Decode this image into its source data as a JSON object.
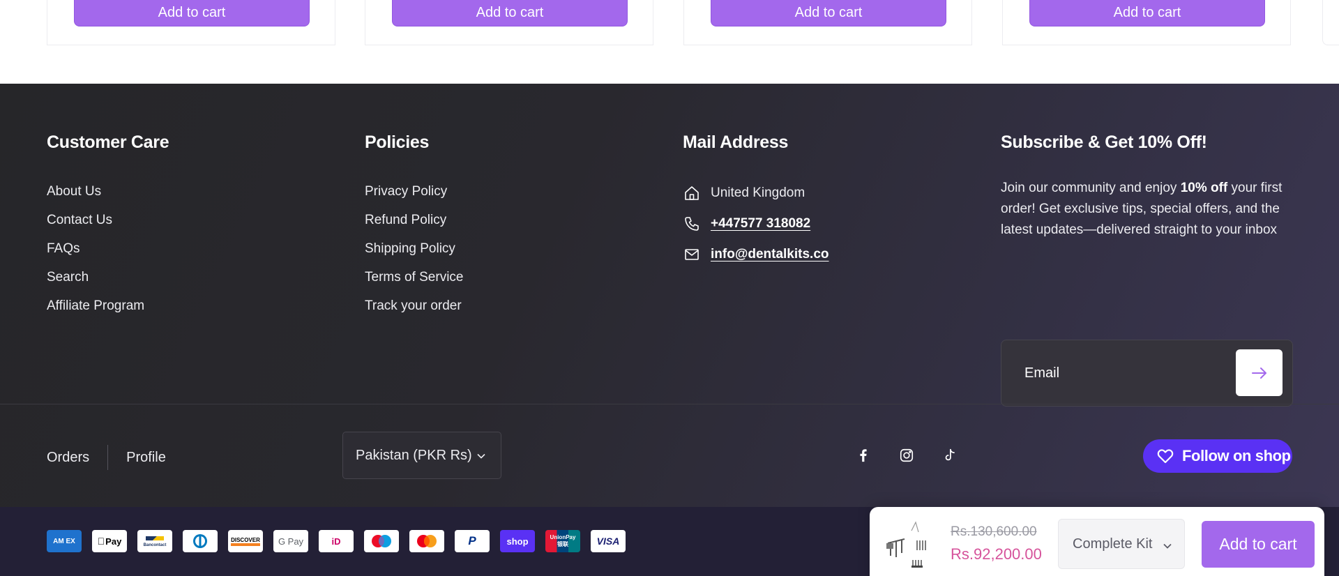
{
  "product_strip": {
    "cards": [
      {
        "button_label": "Add to cart"
      },
      {
        "button_label": "Add to cart"
      },
      {
        "button_label": "Add to cart"
      },
      {
        "button_label": "Add to cart"
      }
    ]
  },
  "footer": {
    "customer_care": {
      "heading": "Customer Care",
      "links": [
        "About Us",
        "Contact Us",
        "FAQs",
        "Search",
        "Affiliate Program"
      ]
    },
    "policies": {
      "heading": "Policies",
      "links": [
        "Privacy Policy",
        "Refund Policy",
        "Shipping Policy",
        "Terms of Service",
        "Track your order"
      ]
    },
    "mail_address": {
      "heading": "Mail Address",
      "location": "United Kingdom",
      "phone": "+447577 318082",
      "email": "info@dentalkits.co",
      "icons": [
        "home-icon",
        "phone-icon",
        "mail-icon"
      ]
    },
    "subscribe": {
      "heading": "Subscribe & Get 10% Off!",
      "text_before": "Join our community and enjoy ",
      "text_bold": "10% off",
      "text_after": " your first order! Get exclusive tips, special offers, and the latest updates—delivered straight to your inbox",
      "email_placeholder": "Email",
      "submit_icon": "arrow-right-icon"
    }
  },
  "bottom": {
    "nav": [
      "Orders",
      "Profile"
    ],
    "country_selector": "Pakistan (PKR Rs)",
    "socials": [
      "facebook-icon",
      "instagram-icon",
      "tiktok-icon"
    ],
    "follow_label": "Follow on shop"
  },
  "payment_methods": [
    {
      "name": "American Express",
      "text": "AM EX"
    },
    {
      "name": "Apple Pay",
      "text": "Pay"
    },
    {
      "name": "Bancontact",
      "text": "Bancontact"
    },
    {
      "name": "Diners Club",
      "text": ""
    },
    {
      "name": "Discover",
      "text": "DISCOVER"
    },
    {
      "name": "Google Pay",
      "text": "G Pay"
    },
    {
      "name": "iDEAL",
      "text": "iD"
    },
    {
      "name": "Maestro",
      "text": ""
    },
    {
      "name": "Mastercard",
      "text": ""
    },
    {
      "name": "PayPal",
      "text": "P"
    },
    {
      "name": "Shop Pay",
      "text": "shop"
    },
    {
      "name": "UnionPay",
      "text": "UnionPay 银联"
    },
    {
      "name": "Visa",
      "text": "VISA"
    }
  ],
  "sticky_cart": {
    "old_price": "Rs.130,600.00",
    "new_price": "Rs.92,200.00",
    "variant": "Complete Kit",
    "button_label": "Add to cart"
  },
  "colors": {
    "accent": "#a368ec",
    "shop_blue": "#5a31f4",
    "sale_price": "#d6539b",
    "footer_bg": "#29282e",
    "payment_bar_bg": "#232036"
  }
}
